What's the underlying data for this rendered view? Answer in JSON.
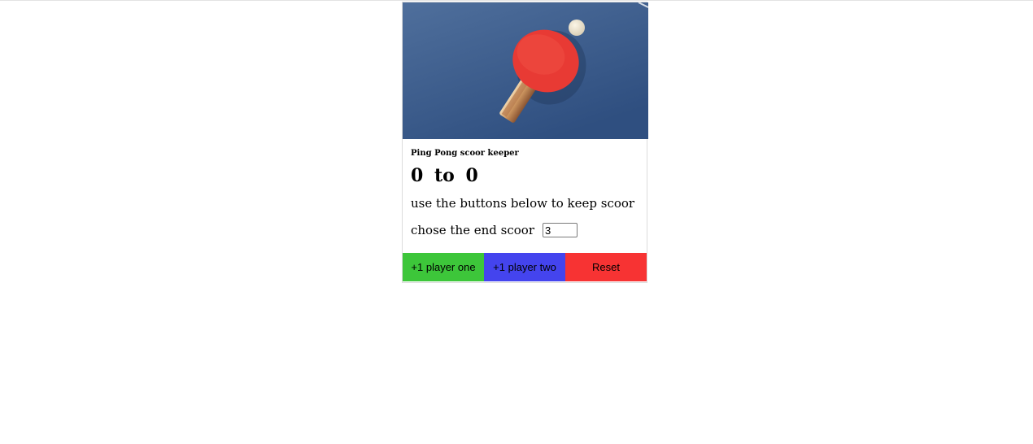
{
  "card": {
    "title": "Ping Pong scoor keeper",
    "score": {
      "player_one": "0",
      "separator": "to",
      "player_two": "0"
    },
    "instructions": "use the buttons below to keep scoor",
    "end_score": {
      "label": "chose the end scoor",
      "value": "3"
    },
    "hero_image": {
      "alt": "ping-pong paddle and ball on blue table"
    }
  },
  "buttons": {
    "player_one": "+1 player one",
    "player_two": "+1 player two",
    "reset": "Reset"
  },
  "colors": {
    "player_one_button": "#3dc63a",
    "player_two_button": "#4444ee",
    "reset_button": "#f73333",
    "table_blue": "#3d5f8e",
    "paddle_red": "#e83a34"
  }
}
